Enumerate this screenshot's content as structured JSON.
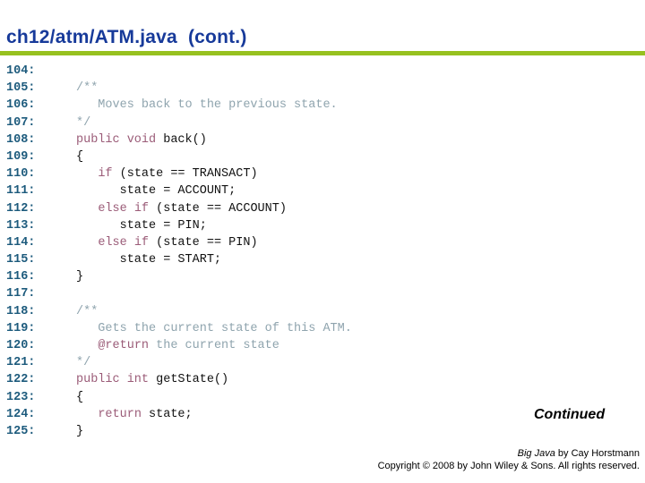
{
  "slide": {
    "title": "ch12/atm/ATM.java  (cont.)",
    "continued_label": "Continued",
    "footer": {
      "book_title": "Big Java",
      "author_line": " by Cay Horstmann",
      "copyright": "Copyright © 2008 by John Wiley & Sons.  All rights reserved."
    }
  },
  "colors": {
    "title": "#173a9a",
    "rule": "#97c11f",
    "line_number": "#1c5a7c",
    "comment": "#8fa4ae",
    "keyword": "#9b5c78",
    "code": "#111111"
  },
  "code": {
    "lines": [
      {
        "number": "104:",
        "tokens": []
      },
      {
        "number": "105:",
        "tokens": [
          {
            "type": "comment",
            "text": "/**"
          }
        ]
      },
      {
        "number": "106:",
        "tokens": [
          {
            "type": "comment",
            "text": "   Moves back to the previous state."
          }
        ]
      },
      {
        "number": "107:",
        "tokens": [
          {
            "type": "comment",
            "text": "*/"
          }
        ]
      },
      {
        "number": "108:",
        "tokens": [
          {
            "type": "keyword",
            "text": "public void"
          },
          {
            "type": "plain",
            "text": " back()"
          }
        ]
      },
      {
        "number": "109:",
        "tokens": [
          {
            "type": "plain",
            "text": "{"
          }
        ]
      },
      {
        "number": "110:",
        "tokens": [
          {
            "type": "plain",
            "text": "   "
          },
          {
            "type": "keyword",
            "text": "if"
          },
          {
            "type": "plain",
            "text": " (state == TRANSACT)"
          }
        ]
      },
      {
        "number": "111:",
        "tokens": [
          {
            "type": "plain",
            "text": "      state = ACCOUNT;"
          }
        ]
      },
      {
        "number": "112:",
        "tokens": [
          {
            "type": "plain",
            "text": "   "
          },
          {
            "type": "keyword",
            "text": "else if"
          },
          {
            "type": "plain",
            "text": " (state == ACCOUNT)"
          }
        ]
      },
      {
        "number": "113:",
        "tokens": [
          {
            "type": "plain",
            "text": "      state = PIN;"
          }
        ]
      },
      {
        "number": "114:",
        "tokens": [
          {
            "type": "plain",
            "text": "   "
          },
          {
            "type": "keyword",
            "text": "else if"
          },
          {
            "type": "plain",
            "text": " (state == PIN)"
          }
        ]
      },
      {
        "number": "115:",
        "tokens": [
          {
            "type": "plain",
            "text": "      state = START;"
          }
        ]
      },
      {
        "number": "116:",
        "tokens": [
          {
            "type": "plain",
            "text": "}"
          }
        ]
      },
      {
        "number": "117:",
        "tokens": []
      },
      {
        "number": "118:",
        "tokens": [
          {
            "type": "comment",
            "text": "/**"
          }
        ]
      },
      {
        "number": "119:",
        "tokens": [
          {
            "type": "comment",
            "text": "   Gets the current state of this ATM."
          }
        ]
      },
      {
        "number": "120:",
        "tokens": [
          {
            "type": "comment",
            "text": "   "
          },
          {
            "type": "keyword",
            "text": "@return"
          },
          {
            "type": "comment",
            "text": " the current state"
          }
        ]
      },
      {
        "number": "121:",
        "tokens": [
          {
            "type": "comment",
            "text": "*/"
          }
        ]
      },
      {
        "number": "122:",
        "tokens": [
          {
            "type": "keyword",
            "text": "public int"
          },
          {
            "type": "plain",
            "text": " getState()"
          }
        ]
      },
      {
        "number": "123:",
        "tokens": [
          {
            "type": "plain",
            "text": "{"
          }
        ]
      },
      {
        "number": "124:",
        "tokens": [
          {
            "type": "plain",
            "text": "   "
          },
          {
            "type": "keyword",
            "text": "return"
          },
          {
            "type": "plain",
            "text": " state;"
          }
        ]
      },
      {
        "number": "125:",
        "tokens": [
          {
            "type": "plain",
            "text": "}"
          }
        ]
      }
    ]
  }
}
